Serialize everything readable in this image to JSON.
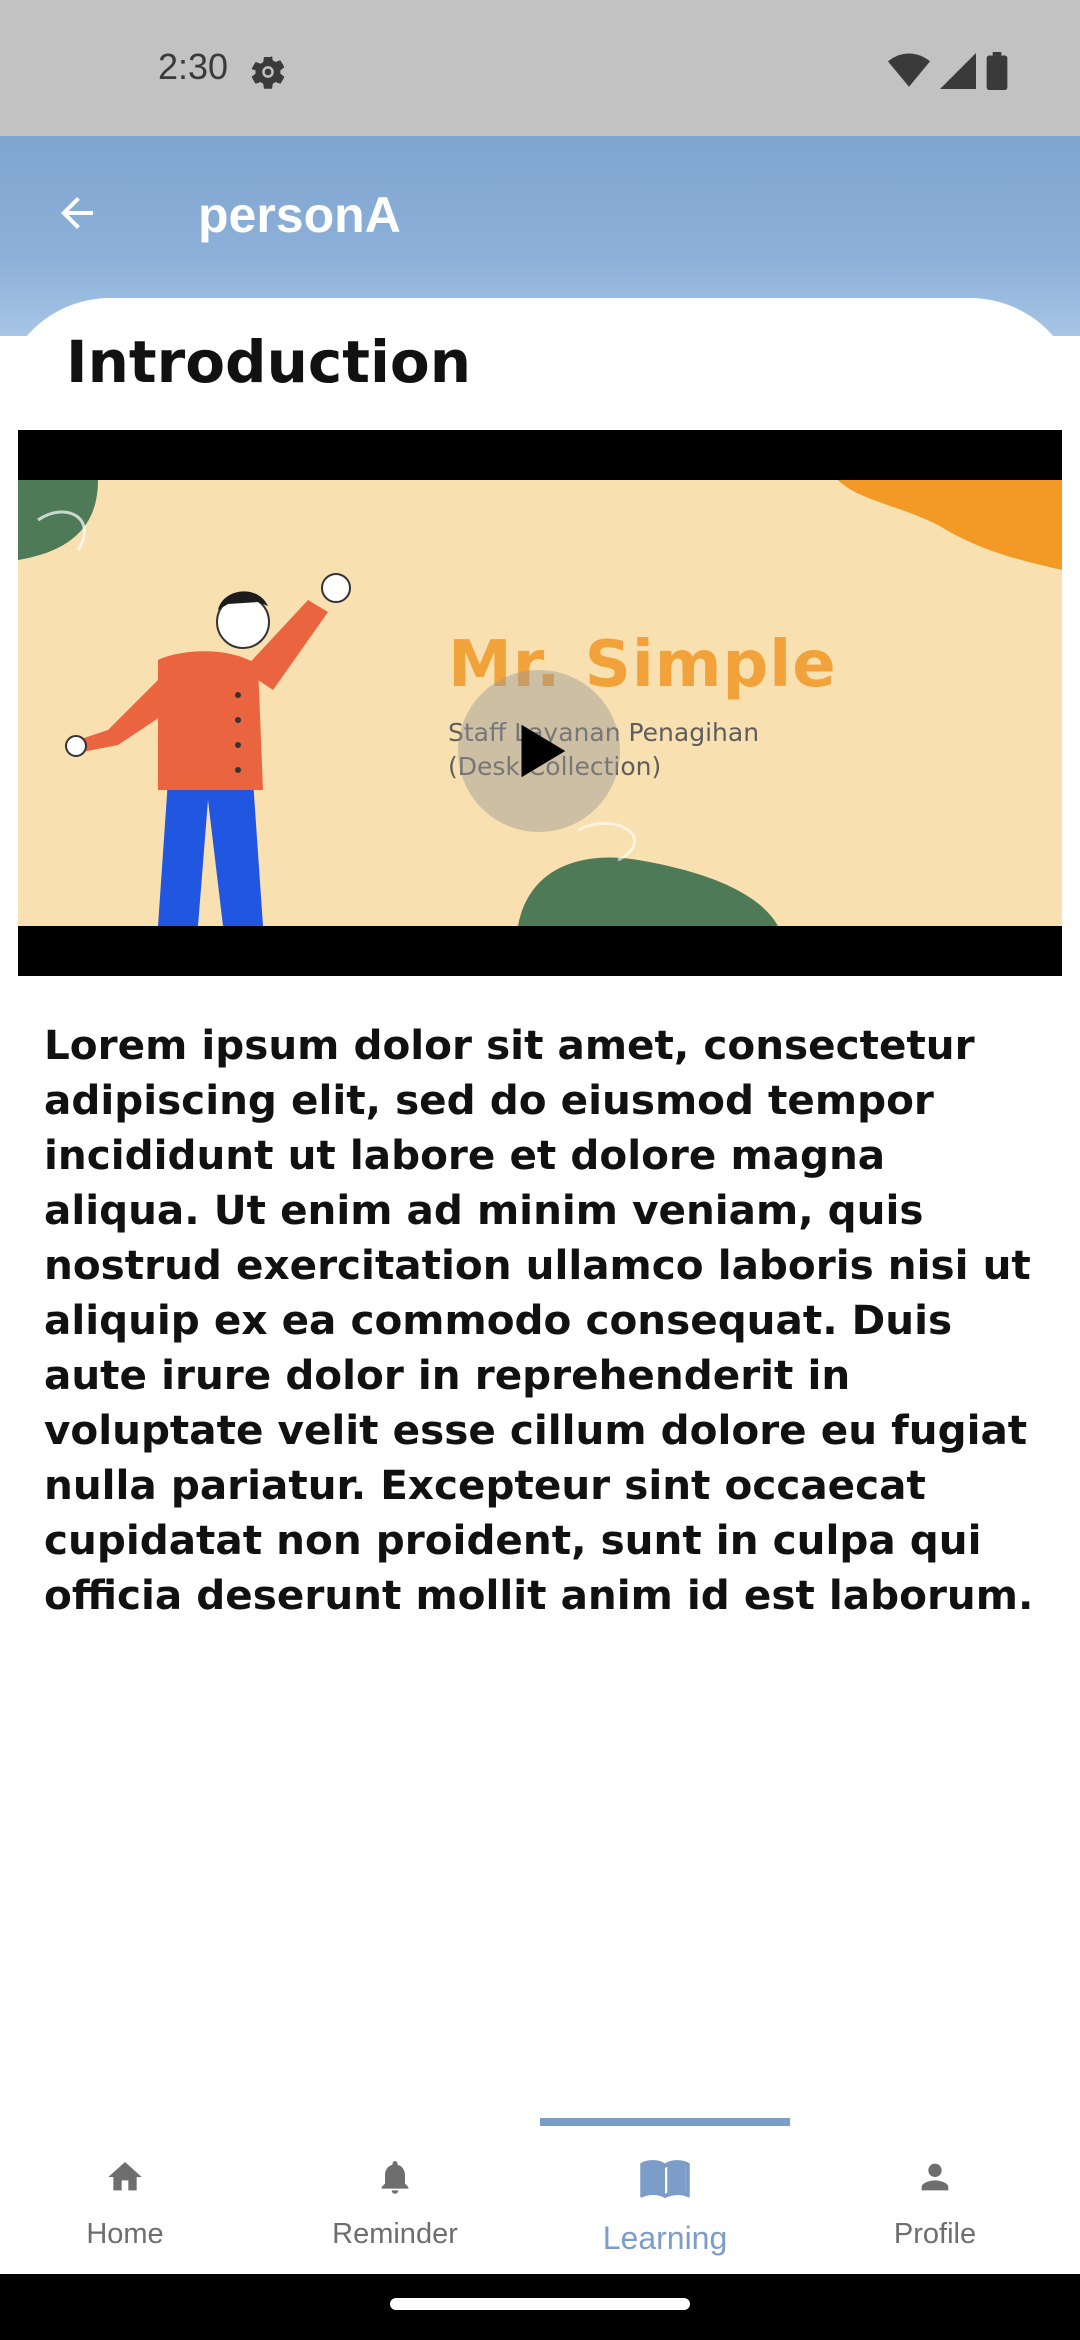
{
  "status_bar": {
    "time": "2:30"
  },
  "app_bar": {
    "title": "personA"
  },
  "content": {
    "section_title": "Introduction",
    "video": {
      "thumbnail_title": "Mr. Simple",
      "thumbnail_line1": "Staff Layanan Penagihan",
      "thumbnail_line2": "(Desk Collection)"
    },
    "paragraph": "Lorem ipsum dolor sit amet, consectetur adipiscing elit, sed do eiusmod tempor incididunt ut labore et dolore magna aliqua. Ut enim ad minim veniam, quis nostrud exercitation ullamco laboris nisi ut aliquip ex ea commodo consequat. Duis aute irure dolor in reprehenderit in voluptate velit esse cillum dolore eu fugiat nulla pariatur. Excepteur sint occaecat cupidatat non proident, sunt in culpa qui officia deserunt mollit anim id est laborum."
  },
  "bottom_nav": {
    "items": [
      {
        "label": "Home",
        "icon": "home-icon"
      },
      {
        "label": "Reminder",
        "icon": "bell-icon"
      },
      {
        "label": "Learning",
        "icon": "book-icon",
        "active": true
      },
      {
        "label": "Profile",
        "icon": "person-icon"
      }
    ]
  },
  "colors": {
    "app_bar": "#7fa4cf",
    "accent": "#7d9dc9",
    "status_bar": "#c2c2c2"
  }
}
